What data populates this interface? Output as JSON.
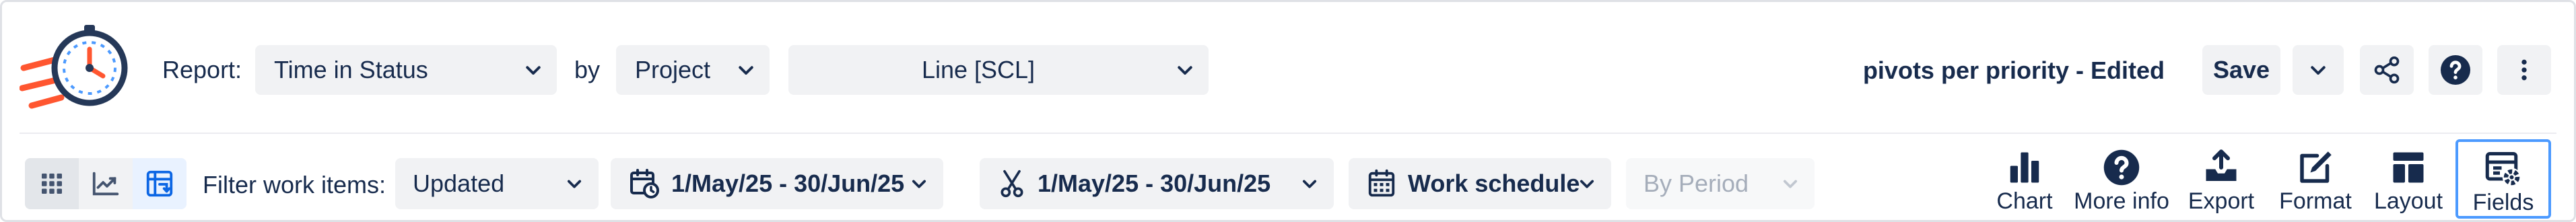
{
  "header": {
    "report_label": "Report:",
    "report_value": "Time in Status",
    "by_label": "by",
    "by_value": "Project",
    "project_value": "Line [SCL]",
    "saved_report_name": "pivots per priority - Edited",
    "save_label": "Save"
  },
  "filters": {
    "label": "Filter work items:",
    "field_value": "Updated",
    "date_range": "1/May/25 - 30/Jun/25",
    "trim_range": "1/May/25 - 30/Jun/25",
    "schedule": "Work schedule",
    "period": "By Period"
  },
  "toolbar": {
    "chart": "Chart",
    "more_info": "More info",
    "export": "Export",
    "format": "Format",
    "layout": "Layout",
    "fields": "Fields"
  },
  "icons": {
    "logo": "stopwatch-logo",
    "view_grid": "grid-icon",
    "view_chart": "line-chart-icon",
    "view_pivot": "pivot-icon",
    "share": "share-icon",
    "help": "help-icon",
    "more": "more-vertical-icon"
  },
  "colors": {
    "accent": "#4c9aff",
    "pivot_icon": "#0c66e4",
    "logo_orange": "#ff5630",
    "text": "#172b4d",
    "button_bg": "#f1f2f4"
  }
}
